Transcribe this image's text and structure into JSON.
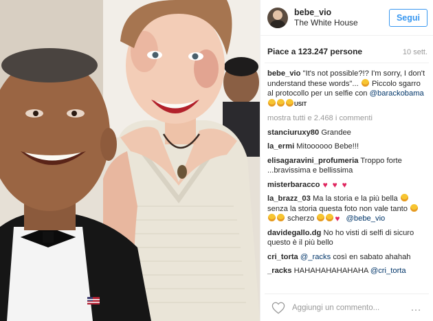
{
  "header": {
    "username": "bebe_vio",
    "location": "The White House",
    "follow_label": "Segui"
  },
  "stats": {
    "likes": "Piace a 123.247 persone",
    "time_ago": "10 sett."
  },
  "caption": {
    "user": "bebe_vio",
    "text_1": "\"It's not possible?!? I'm sorry, I don't understand these words\"...",
    "text_2": "Piccolo sgarro al protocollo per un selfie con",
    "mention": "@barackobama",
    "suffix": "USIT"
  },
  "show_all": "mostra tutti e 2.468 i commenti",
  "comments": [
    {
      "user": "stanciuruxy80",
      "text": "Grandee"
    },
    {
      "user": "la_ermi",
      "text": "Mitoooooo Bebe!!!"
    },
    {
      "user": "elisagaravini_profumeria",
      "text": "Troppo forte ...bravissima e bellissima"
    },
    {
      "user": "misterbaracco",
      "text": ""
    },
    {
      "user": "la_brazz_03",
      "text_1": "Ma la storia e la più bella",
      "text_2": "senza la storia questa foto non vale tanto",
      "text_3": "scherzo",
      "mention": "@bebe_vio"
    },
    {
      "user": "davidegallo.dg",
      "text": "No ho visti di selfi di sicuro questo è il più bello"
    },
    {
      "user": "cri_torta",
      "mention": "@_racks",
      "text": "così en sabato ahahah"
    },
    {
      "user": "_racks",
      "text": "HAHAHAHAHAHAHA",
      "mention": "@cri_torta"
    }
  ],
  "footer": {
    "placeholder": "Aggiungi un commento...",
    "more_icon": "…"
  },
  "icons": [
    "heart-icon",
    "more-options-icon",
    "avatar"
  ],
  "colors": {
    "accent": "#3897f0",
    "mention": "#003569",
    "muted": "#999999",
    "heart_red": "#e0245e"
  }
}
